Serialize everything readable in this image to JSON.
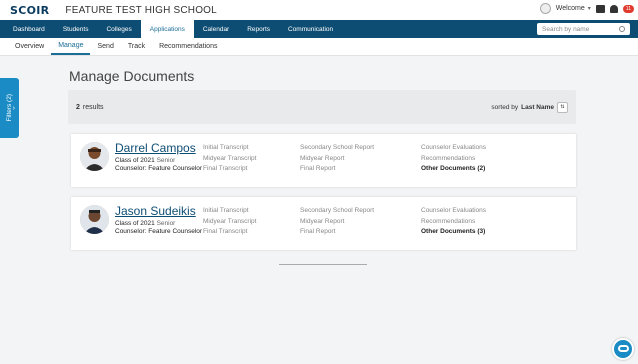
{
  "header": {
    "logo": "SCOIR",
    "school": "FEATURE TEST HIGH SCHOOL",
    "welcome": "Welcome",
    "notifications": "11"
  },
  "mainnav": {
    "tabs": [
      "Dashboard",
      "Students",
      "Colleges",
      "Applications",
      "Calendar",
      "Reports",
      "Communication"
    ],
    "search_placeholder": "Search by name"
  },
  "subnav": {
    "tabs": [
      "Overview",
      "Manage",
      "Send",
      "Track",
      "Recommendations"
    ]
  },
  "filters": {
    "label": "Filters (2)"
  },
  "page": {
    "title": "Manage Documents"
  },
  "results": {
    "count": "2",
    "label": "results",
    "sorted_by": "sorted by",
    "sort_field": "Last Name"
  },
  "students": [
    {
      "name": "Darrel Campos",
      "class": "Class of 2021",
      "level": "Senior",
      "counselor": "Counselor: Feature Counselor",
      "col1": [
        "Initial Transcript",
        "Midyear Transcript",
        "Final Transcript"
      ],
      "col2": [
        "Secondary School Report",
        "Midyear Report",
        "Final Report"
      ],
      "col3": [
        "Counselor Evaluations",
        "Recommendations",
        "Other Documents (2)"
      ]
    },
    {
      "name": "Jason Sudeikis",
      "class": "Class of 2021",
      "level": "Senior",
      "counselor": "Counselor: Feature Counselor",
      "col1": [
        "Initial Transcript",
        "Midyear Transcript",
        "Final Transcript"
      ],
      "col2": [
        "Secondary School Report",
        "Midyear Report",
        "Final Report"
      ],
      "col3": [
        "Counselor Evaluations",
        "Recommendations",
        "Other Documents (3)"
      ]
    }
  ]
}
